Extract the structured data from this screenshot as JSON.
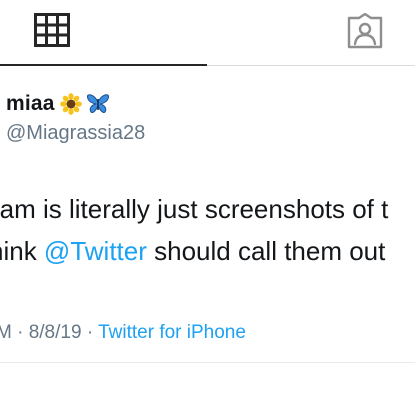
{
  "tabs": {
    "grid_icon": "grid-icon",
    "tagged_icon": "tagged-icon",
    "active_tab": "grid"
  },
  "tweet": {
    "display_name": "miaa",
    "emojis": [
      "sunflower",
      "butterfly"
    ],
    "handle": "@Miagrassia28",
    "text_line_1": "ram is literally just screenshots of t",
    "text_line_2_prefix": "hink ",
    "text_line_2_mention": "@Twitter",
    "text_line_2_suffix": " should call them out",
    "meta_time_date": "M · 8/8/19 · ",
    "meta_source": "Twitter for iPhone"
  },
  "colors": {
    "link_blue": "#1da1f2",
    "secondary_gray": "#657786",
    "text_dark": "#14171a",
    "tab_active": "#262626"
  }
}
